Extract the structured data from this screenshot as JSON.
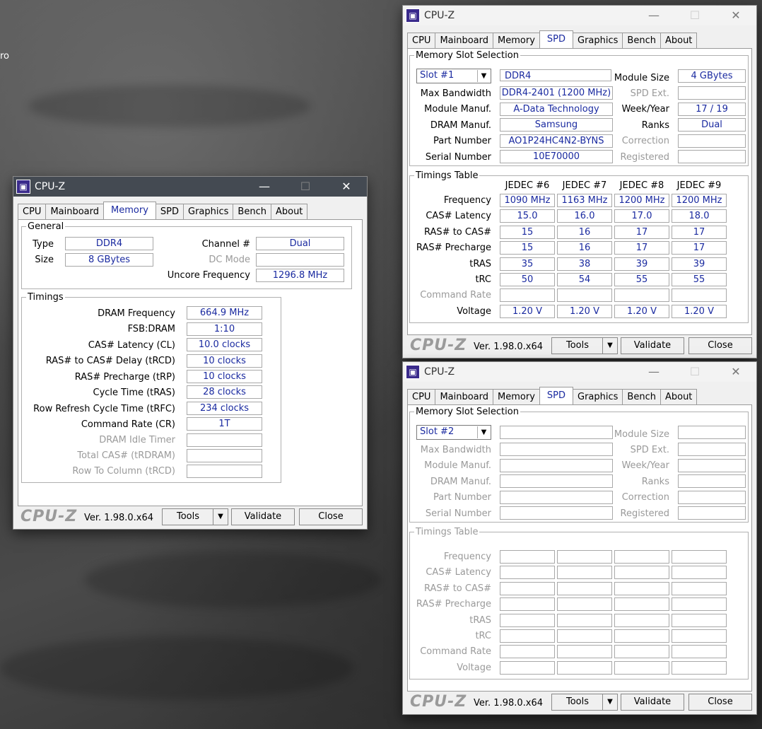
{
  "desktop": {
    "partial_text": "ro"
  },
  "app": {
    "title": "CPU-Z",
    "brand": "CPU-Z",
    "version": "Ver. 1.98.0.x64",
    "tools": "Tools",
    "validate": "Validate",
    "close": "Close",
    "minimize": "—",
    "maximize": "☐",
    "close_glyph": "✕"
  },
  "tabs": [
    "CPU",
    "Mainboard",
    "Memory",
    "SPD",
    "Graphics",
    "Bench",
    "About"
  ],
  "memory": {
    "general_title": "General",
    "type_label": "Type",
    "type_value": "DDR4",
    "size_label": "Size",
    "size_value": "8 GBytes",
    "channel_label": "Channel #",
    "channel_value": "Dual",
    "dcmode_label": "DC Mode",
    "dcmode_value": "",
    "uncore_label": "Uncore Frequency",
    "uncore_value": "1296.8 MHz",
    "timings_title": "Timings",
    "timings": [
      {
        "label": "DRAM Frequency",
        "value": "664.9 MHz",
        "dim": false
      },
      {
        "label": "FSB:DRAM",
        "value": "1:10",
        "dim": false
      },
      {
        "label": "CAS# Latency (CL)",
        "value": "10.0 clocks",
        "dim": false
      },
      {
        "label": "RAS# to CAS# Delay (tRCD)",
        "value": "10 clocks",
        "dim": false
      },
      {
        "label": "RAS# Precharge (tRP)",
        "value": "10 clocks",
        "dim": false
      },
      {
        "label": "Cycle Time (tRAS)",
        "value": "28 clocks",
        "dim": false
      },
      {
        "label": "Row Refresh Cycle Time (tRFC)",
        "value": "234 clocks",
        "dim": false
      },
      {
        "label": "Command Rate (CR)",
        "value": "1T",
        "dim": false
      },
      {
        "label": "DRAM Idle Timer",
        "value": "",
        "dim": true
      },
      {
        "label": "Total CAS# (tRDRAM)",
        "value": "",
        "dim": true
      },
      {
        "label": "Row To Column (tRCD)",
        "value": "",
        "dim": true
      }
    ]
  },
  "spd_labels": {
    "slot_group": "Memory Slot Selection",
    "max_bw": "Max Bandwidth",
    "module_manuf": "Module Manuf.",
    "dram_manuf": "DRAM Manuf.",
    "part_number": "Part Number",
    "serial_number": "Serial Number",
    "module_size": "Module Size",
    "spd_ext": "SPD Ext.",
    "week_year": "Week/Year",
    "ranks": "Ranks",
    "correction": "Correction",
    "registered": "Registered",
    "timings_table": "Timings Table",
    "rows": [
      "Frequency",
      "CAS# Latency",
      "RAS# to CAS#",
      "RAS# Precharge",
      "tRAS",
      "tRC",
      "Command Rate",
      "Voltage"
    ]
  },
  "spd1": {
    "slot": "Slot #1",
    "type": "DDR4",
    "max_bw": "DDR4-2401 (1200 MHz)",
    "module_manuf": "A-Data Technology",
    "dram_manuf": "Samsung",
    "part_number": "AO1P24HC4N2-BYNS",
    "serial_number": "10E70000",
    "module_size": "4 GBytes",
    "spd_ext": "",
    "week_year": "17 / 19",
    "ranks": "Dual",
    "correction": "",
    "registered": "",
    "columns": [
      "JEDEC #6",
      "JEDEC #7",
      "JEDEC #8",
      "JEDEC #9"
    ],
    "table": [
      [
        "1090 MHz",
        "1163 MHz",
        "1200 MHz",
        "1200 MHz"
      ],
      [
        "15.0",
        "16.0",
        "17.0",
        "18.0"
      ],
      [
        "15",
        "16",
        "17",
        "17"
      ],
      [
        "15",
        "16",
        "17",
        "17"
      ],
      [
        "35",
        "38",
        "39",
        "39"
      ],
      [
        "50",
        "54",
        "55",
        "55"
      ],
      [
        "",
        "",
        "",
        ""
      ],
      [
        "1.20 V",
        "1.20 V",
        "1.20 V",
        "1.20 V"
      ]
    ]
  },
  "spd2": {
    "slot": "Slot #2"
  }
}
